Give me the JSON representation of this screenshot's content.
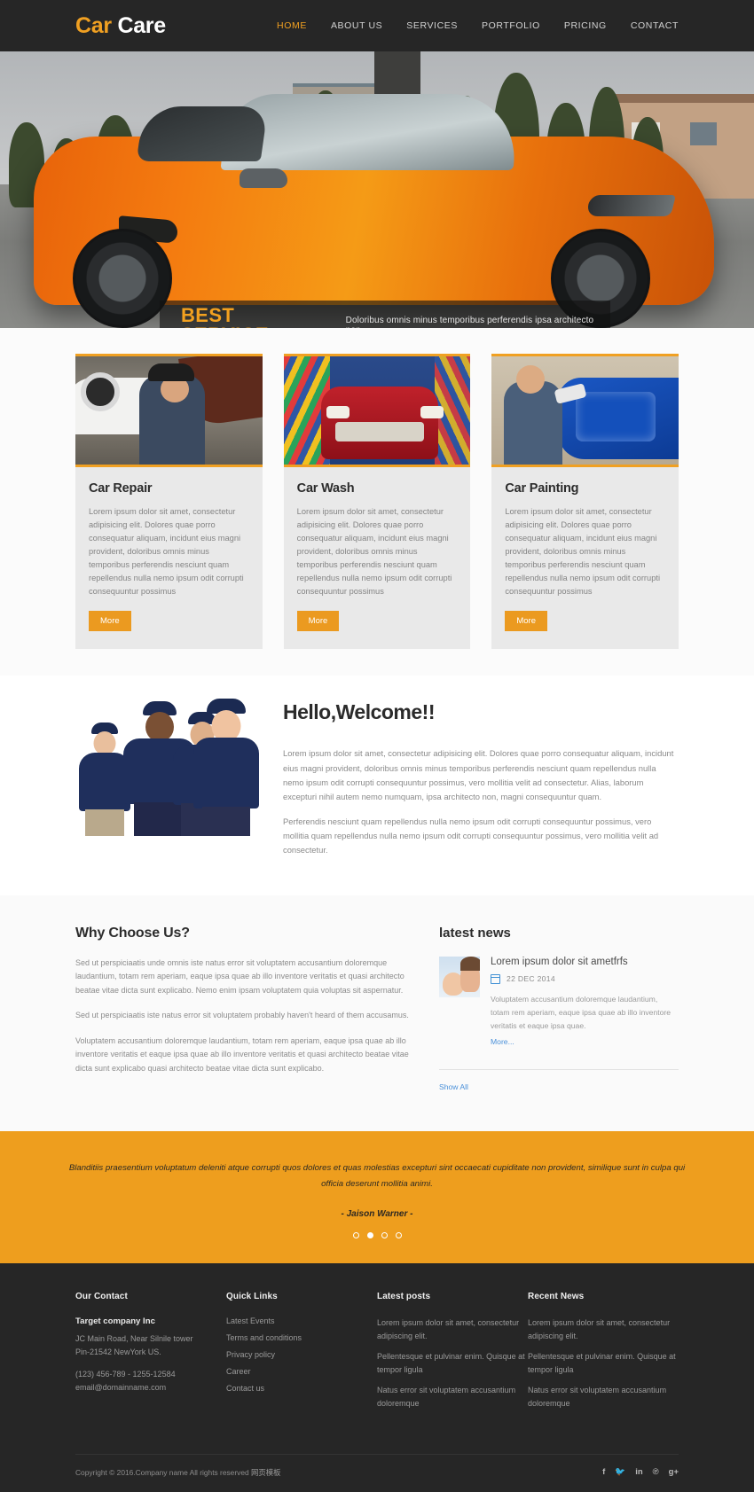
{
  "header": {
    "logo_part1": "Car",
    "logo_part2": "Care",
    "nav": [
      {
        "label": "HOME",
        "active": true
      },
      {
        "label": "ABOUT US",
        "active": false
      },
      {
        "label": "SERVICES",
        "active": false
      },
      {
        "label": "PORTFOLIO",
        "active": false
      },
      {
        "label": "PRICING",
        "active": false
      },
      {
        "label": "CONTACT",
        "active": false
      }
    ]
  },
  "banner": {
    "caption_title": "BEST SERVICE",
    "caption_text": "Doloribus omnis minus temporibus perferendis ipsa architecto non."
  },
  "services": {
    "cards": [
      {
        "title": "Car Repair",
        "text": "Lorem ipsum dolor sit amet, consectetur adipisicing elit. Dolores quae porro consequatur aliquam, incidunt eius magni provident, doloribus omnis minus temporibus perferendis nesciunt quam repellendus nulla nemo ipsum odit corrupti consequuntur possimus",
        "button": "More",
        "image_name": "car-repair-mechanic-photo"
      },
      {
        "title": "Car Wash",
        "text": "Lorem ipsum dolor sit amet, consectetur adipisicing elit. Dolores quae porro consequatur aliquam, incidunt eius magni provident, doloribus omnis minus temporibus perferendis nesciunt quam repellendus nulla nemo ipsum odit corrupti consequuntur possimus",
        "button": "More",
        "image_name": "car-wash-red-car-photo"
      },
      {
        "title": "Car Painting",
        "text": "Lorem ipsum dolor sit amet, consectetur adipisicing elit. Dolores quae porro consequatur aliquam, incidunt eius magni provident, doloribus omnis minus temporibus perferendis nesciunt quam repellendus nulla nemo ipsum odit corrupti consequuntur possimus",
        "button": "More",
        "image_name": "car-painting-blue-door-photo"
      }
    ]
  },
  "welcome": {
    "title": "Hello,Welcome!!",
    "para1": "Lorem ipsum dolor sit amet, consectetur adipisicing elit. Dolores quae porro consequatur aliquam, incidunt eius magni provident, doloribus omnis minus temporibus perferendis nesciunt quam repellendus nulla nemo ipsum odit corrupti consequuntur possimus, vero mollitia velit ad consectetur. Alias, laborum excepturi nihil autem nemo numquam, ipsa architecto non, magni consequuntur quam.",
    "para2": "Perferendis nesciunt quam repellendus nulla nemo ipsum odit corrupti consequuntur possimus, vero mollitia quam repellendus nulla nemo ipsum odit corrupti consequuntur possimus, vero mollitia velit ad consectetur.",
    "image_name": "team-staff-photo"
  },
  "why": {
    "title": "Why Choose Us?",
    "para1": "Sed ut perspiciaatis unde omnis iste natus error sit voluptatem accusantium doloremque laudantium, totam rem aperiam, eaque ipsa quae ab illo inventore veritatis et quasi architecto beatae vitae dicta sunt explicabo. Nemo enim ipsam voluptatem quia voluptas sit aspernatur.",
    "para2": "Sed ut perspiciaatis iste natus error sit voluptatem probably haven't heard of them accusamus.",
    "para3": "Voluptatem accusantium doloremque laudantium, totam rem aperiam, eaque ipsa quae ab illo inventore veritatis et eaque ipsa quae ab illo inventore veritatis et quasi architecto beatae vitae dicta sunt explicabo quasi architecto beatae vitae dicta sunt explicabo."
  },
  "news": {
    "title": "latest news",
    "item": {
      "headline": "Lorem ipsum dolor sit ametfrfs",
      "date": "22 DEC 2014",
      "body": "Voluptatem accusantium doloremque laudantium, totam rem aperiam, eaque ipsa quae ab illo inventore veritatis et eaque ipsa quae.",
      "more_link": "More...",
      "thumb_name": "baby-and-mother-thumbnail"
    },
    "show_all": "Show All"
  },
  "testimonial": {
    "quote": "Blanditiis praesentium voluptatum deleniti atque corrupti quos dolores et quas molestias excepturi sint occaecati cupiditate non provident, similique sunt in culpa qui officia deserunt mollitia animi.",
    "author": "- Jaison Warner -",
    "dots_total": 4,
    "active_dot": 2
  },
  "footer": {
    "col1": {
      "heading": "Our Contact",
      "company": "Target company Inc",
      "address1": "JC Main Road, Near Silnile tower",
      "address2": "Pin-21542 NewYork US.",
      "phone": "(123) 456-789 - 1255-12584",
      "email": "email@domainname.com"
    },
    "col2": {
      "heading": "Quick Links",
      "links": [
        "Latest Events",
        "Terms and conditions",
        "Privacy policy",
        "Career",
        "Contact us"
      ]
    },
    "col3": {
      "heading": "Latest posts",
      "posts": [
        "Lorem ipsum dolor sit amet, consectetur adipiscing elit.",
        "Pellentesque et pulvinar enim. Quisque at tempor ligula",
        "Natus error sit voluptatem accusantium doloremque"
      ]
    },
    "col4": {
      "heading": "Recent News",
      "posts": [
        "Lorem ipsum dolor sit amet, consectetur adipiscing elit.",
        "Pellentesque et pulvinar enim. Quisque at tempor ligula",
        "Natus error sit voluptatem accusantium doloremque"
      ]
    },
    "copyright": "Copyright © 2016.Company name All rights reserved ",
    "copyright_cn": "网页模板",
    "socials": [
      {
        "name": "facebook-icon",
        "glyph": "f"
      },
      {
        "name": "twitter-icon",
        "glyph": "🐦"
      },
      {
        "name": "linkedin-icon",
        "glyph": "in"
      },
      {
        "name": "pinterest-icon",
        "glyph": "℗"
      },
      {
        "name": "googleplus-icon",
        "glyph": "g+"
      }
    ],
    "scroll_top": "^"
  },
  "colors": {
    "accent": "#f0a022",
    "dark": "#262626",
    "testimonial_bg": "#ee9e1e",
    "link_blue": "#4a90d9"
  }
}
